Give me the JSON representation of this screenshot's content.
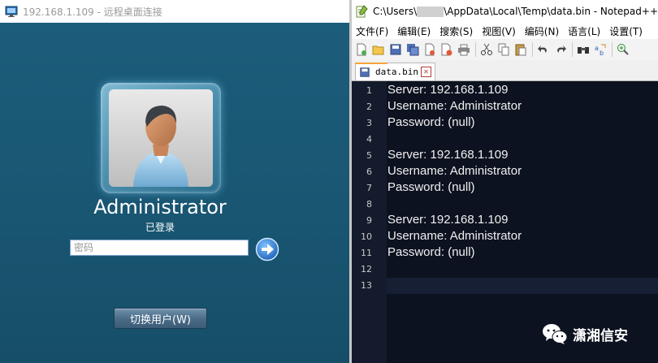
{
  "rdp": {
    "title": "192.168.1.109 - 远程桌面连接",
    "user_name": "Administrator",
    "user_status": "已登录",
    "password_placeholder": "密码",
    "switch_user_label": "切换用户(W)"
  },
  "notepad": {
    "title_prefix": "C:\\Users\\",
    "title_suffix": "\\AppData\\Local\\Temp\\data.bin - Notepad++",
    "menu": [
      "文件(F)",
      "编辑(E)",
      "搜索(S)",
      "视图(V)",
      "编码(N)",
      "语言(L)",
      "设置(T)"
    ],
    "tab_label": "data.bin",
    "lines": [
      {
        "num": "1",
        "text": "Server: 192.168.1.109"
      },
      {
        "num": "2",
        "text": "Username: Administrator"
      },
      {
        "num": "3",
        "text": "Password: (null)"
      },
      {
        "num": "4",
        "text": ""
      },
      {
        "num": "5",
        "text": "Server: 192.168.1.109"
      },
      {
        "num": "6",
        "text": "Username: Administrator"
      },
      {
        "num": "7",
        "text": "Password: (null)"
      },
      {
        "num": "8",
        "text": ""
      },
      {
        "num": "9",
        "text": "Server: 192.168.1.109"
      },
      {
        "num": "10",
        "text": "Username: Administrator"
      },
      {
        "num": "11",
        "text": "Password: (null)"
      },
      {
        "num": "12",
        "text": ""
      },
      {
        "num": "13",
        "text": ""
      }
    ]
  },
  "watermark": {
    "text": "潇湘信安",
    "icon": "wechat-icon"
  },
  "colors": {
    "rdp_bg": "#1b5a78",
    "editor_bg": "#0d1220",
    "editor_text": "#f0f0f0"
  }
}
